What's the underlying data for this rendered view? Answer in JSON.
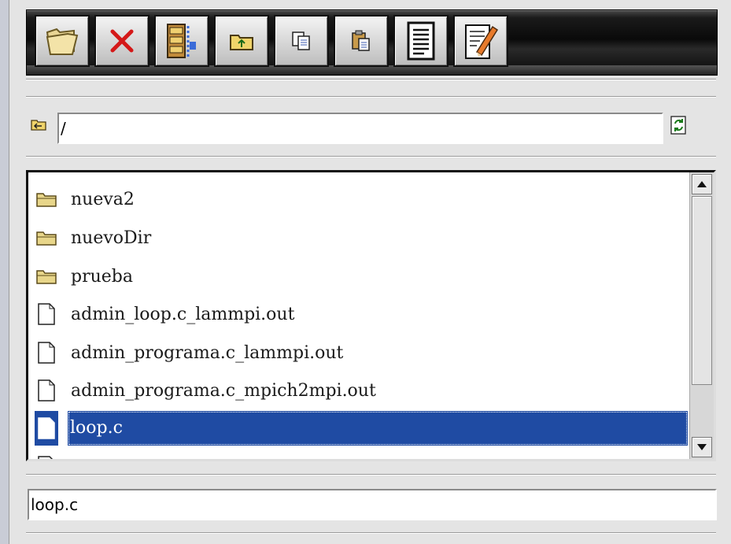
{
  "toolbar": {
    "buttons": [
      {
        "name": "open-folder-button",
        "icon": "open-folder-icon"
      },
      {
        "name": "delete-button",
        "icon": "delete-x-icon"
      },
      {
        "name": "compress-button",
        "icon": "archive-icon"
      },
      {
        "name": "parent-directory-button",
        "icon": "folder-up-icon"
      },
      {
        "name": "copy-button",
        "icon": "copy-icon"
      },
      {
        "name": "paste-button",
        "icon": "paste-icon"
      },
      {
        "name": "view-file-button",
        "icon": "document-icon"
      },
      {
        "name": "edit-file-button",
        "icon": "edit-pencil-icon"
      }
    ]
  },
  "path_bar": {
    "value": "/",
    "icon": "back-folder-icon",
    "refresh_icon": "refresh-icon"
  },
  "files": [
    {
      "name": "nueva2",
      "type": "folder",
      "selected": false
    },
    {
      "name": "nuevoDir",
      "type": "folder",
      "selected": false
    },
    {
      "name": "prueba",
      "type": "folder",
      "selected": false
    },
    {
      "name": "admin_loop.c_lammpi.out",
      "type": "file",
      "selected": false
    },
    {
      "name": "admin_programa.c_lammpi.out",
      "type": "file",
      "selected": false
    },
    {
      "name": "admin_programa.c_mpich2mpi.out",
      "type": "file",
      "selected": false
    },
    {
      "name": "loop.c",
      "type": "file",
      "selected": true
    }
  ],
  "filename_field": {
    "value": "loop.c"
  },
  "colors": {
    "selection": "#1f4ba3",
    "folder": "#e8d68a",
    "delete": "#d41818"
  }
}
